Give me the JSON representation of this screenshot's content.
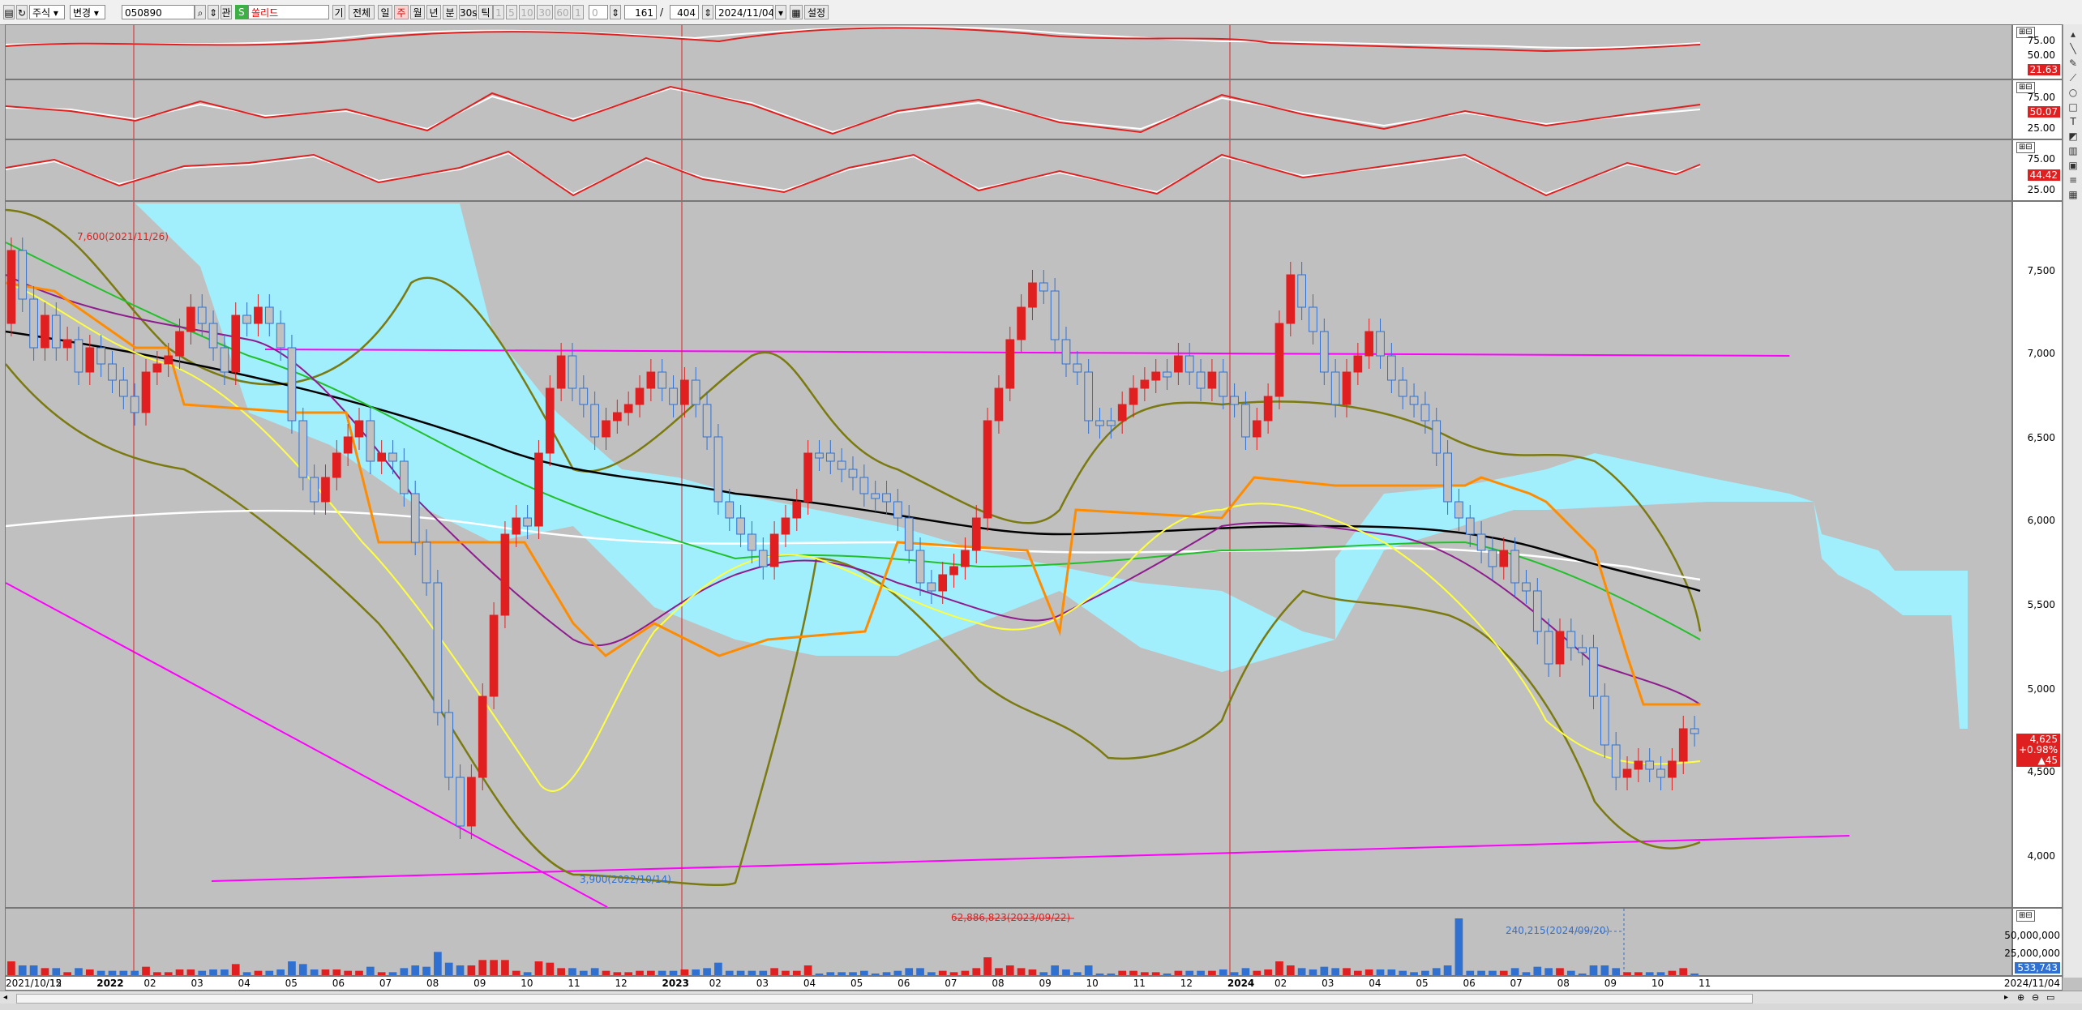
{
  "toolbar": {
    "market": "주식",
    "change": "변경",
    "code": "050890",
    "name": "쏠리드",
    "gi": "기",
    "all": "전체",
    "periods": [
      "일",
      "주",
      "월",
      "년",
      "분",
      "30s",
      "틱"
    ],
    "active_period": "주",
    "minute_options": [
      "1",
      "5",
      "10",
      "30",
      "60",
      "1"
    ],
    "count_label": "0",
    "count": "161",
    "slash": "/",
    "total": "404",
    "date": "2024/11/04",
    "settings": "설정"
  },
  "oscillators": [
    {
      "ticks": [
        "75.00",
        "50.00"
      ],
      "value": "21.63",
      "value_color": "#e02020"
    },
    {
      "ticks": [
        "75.00",
        "50.00",
        "25.00"
      ],
      "value": "50.07",
      "value_color": "#e02020"
    },
    {
      "ticks": [
        "75.00",
        "50.00",
        "25.00"
      ],
      "value": "44.42",
      "value_color": "#e02020"
    }
  ],
  "price_axis": {
    "ticks": [
      "7,500",
      "7,000",
      "6,500",
      "6,000",
      "5,500",
      "5,000",
      "4,500",
      "4,000"
    ],
    "current": {
      "price": "4,625",
      "change_pct": "+0.98%",
      "change": "▲45"
    }
  },
  "volume_axis": {
    "ticks": [
      "50,000,000",
      "25,000,000"
    ],
    "current": "533,743"
  },
  "annotations": {
    "high": "7,600(2021/11/26)",
    "low": "3,900(2022/10/14)",
    "vol_peak": "62,886,823(2023/09/22)",
    "vol_recent": "240,215(2024/09/20)"
  },
  "dates": [
    "2021/10/15",
    "12",
    "2022",
    "02",
    "03",
    "04",
    "05",
    "06",
    "07",
    "08",
    "09",
    "10",
    "11",
    "12",
    "2023",
    "02",
    "03",
    "04",
    "05",
    "06",
    "07",
    "08",
    "09",
    "10",
    "11",
    "12",
    "2024",
    "02",
    "03",
    "04",
    "05",
    "06",
    "07",
    "08",
    "09",
    "10",
    "11"
  ],
  "end_date": "2024/11/04",
  "colors": {
    "up": "#e02020",
    "down": "#3070d0",
    "cloud": "#9ff0ff",
    "trend": "#ff00ff",
    "ma_black": "#000000",
    "ma_white": "#ffffff"
  }
}
